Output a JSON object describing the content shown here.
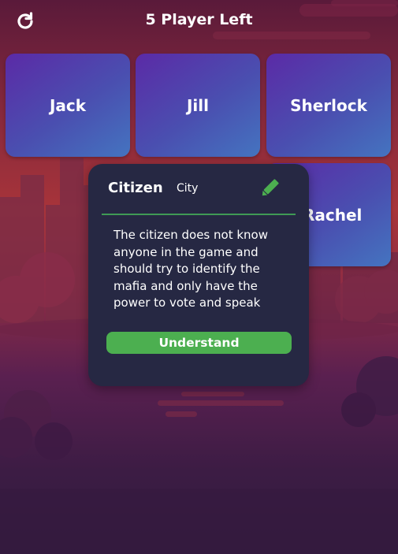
{
  "header": {
    "title": "5 Player Left",
    "refresh_icon": "refresh-icon"
  },
  "players": [
    {
      "name": "Jack"
    },
    {
      "name": "Jill"
    },
    {
      "name": "Sherlock"
    },
    {
      "name": "Rachel"
    }
  ],
  "role_modal": {
    "role": "Citizen",
    "team": "City",
    "edit_icon": "pencil-icon",
    "description": "The citizen does not know anyone in the game and should try to identify the mafia and only have the power to vote and speak",
    "button_label": "Understand"
  },
  "colors": {
    "card_gradient_start": "#5b2aa6",
    "card_gradient_end": "#4474c0",
    "modal_bg": "#262843",
    "accent_green": "#4caf50"
  }
}
